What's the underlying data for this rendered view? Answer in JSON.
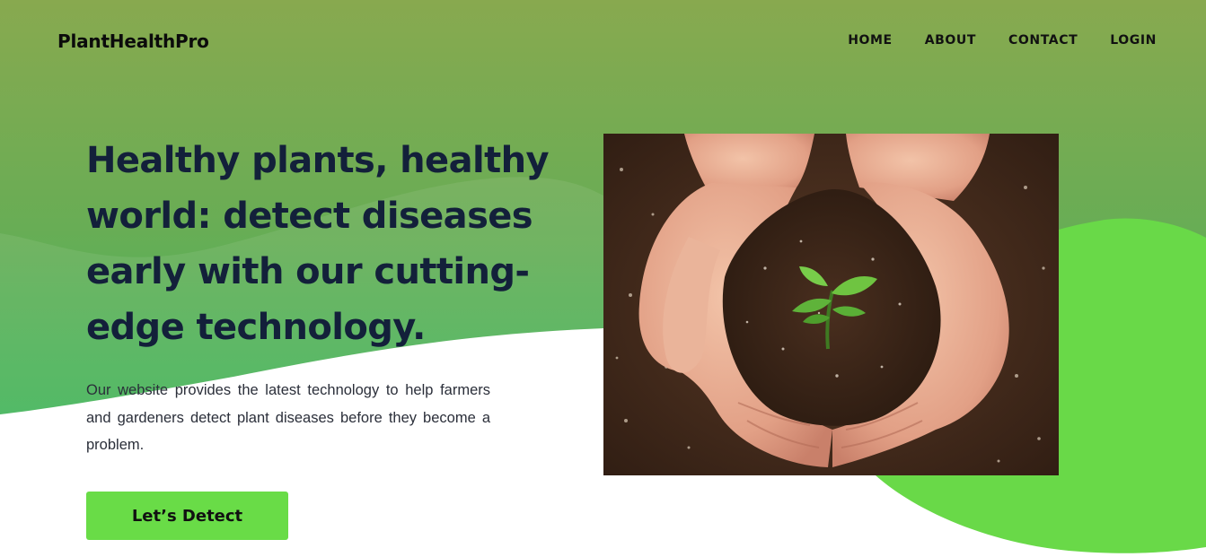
{
  "brand": {
    "logo_text": "PlantHealthPro"
  },
  "nav": {
    "items": [
      {
        "label": "HOME"
      },
      {
        "label": "ABOUT"
      },
      {
        "label": "CONTACT"
      },
      {
        "label": "LOGIN"
      }
    ]
  },
  "hero": {
    "headline": "Healthy plants, healthy world: detect diseases early with our cutting-edge technology.",
    "description": "Our website provides the latest technology to help farmers and gardeners detect plant diseases before they become a problem.",
    "cta_label": "Let’s Detect",
    "image": "hands-holding-soil-with-seedling"
  },
  "colors": {
    "header_gradient_top": "#88a94f",
    "header_gradient_bottom": "#4fb05a",
    "accent_green": "#69dc47",
    "headline_text": "#13203a"
  }
}
